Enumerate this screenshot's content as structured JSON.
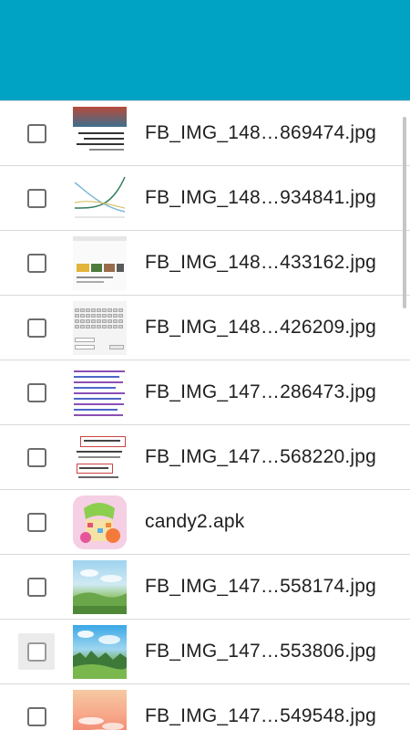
{
  "app_bar": {
    "color": "#00a3c4"
  },
  "files": [
    {
      "name": "FB_IMG_148…869474.jpg",
      "thumb": "thumb-arabic-text-icon"
    },
    {
      "name": "FB_IMG_148…934841.jpg",
      "thumb": "thumb-line-chart-icon"
    },
    {
      "name": "FB_IMG_148…433162.jpg",
      "thumb": "thumb-webpage-icon"
    },
    {
      "name": "FB_IMG_148…426209.jpg",
      "thumb": "thumb-keyboard-icon"
    },
    {
      "name": "FB_IMG_147…286473.jpg",
      "thumb": "thumb-code-icon"
    },
    {
      "name": "FB_IMG_147…568220.jpg",
      "thumb": "thumb-game-text-icon"
    },
    {
      "name": "candy2.apk",
      "thumb": "thumb-candy-app-icon"
    },
    {
      "name": "FB_IMG_147…558174.jpg",
      "thumb": "thumb-landscape-icon"
    },
    {
      "name": "FB_IMG_147…553806.jpg",
      "thumb": "thumb-landscape-icon"
    },
    {
      "name": "FB_IMG_147…549548.jpg",
      "thumb": "thumb-sunset-icon"
    }
  ]
}
